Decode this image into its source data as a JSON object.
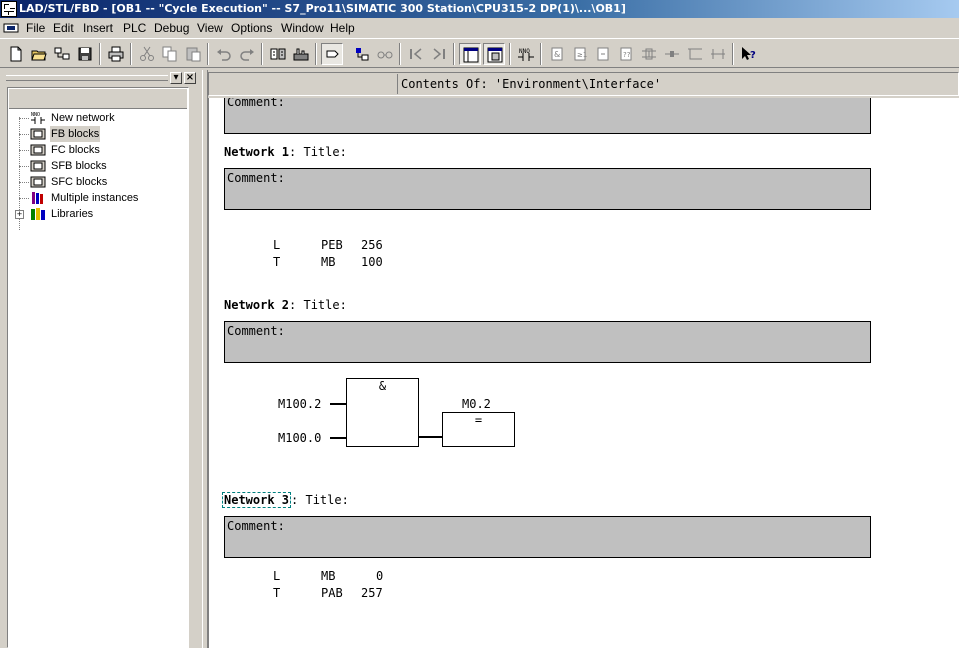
{
  "window": {
    "title": "LAD/STL/FBD  - [OB1 -- \"Cycle Execution\" -- S7_Pro11\\SIMATIC 300 Station\\CPU315-2 DP(1)\\...\\OB1]"
  },
  "menu": [
    "File",
    "Edit",
    "Insert",
    "PLC",
    "Debug",
    "View",
    "Options",
    "Window",
    "Help"
  ],
  "left_panel": {
    "close_glyph": "×",
    "pin_glyph": "▾",
    "tree": [
      {
        "label": "New network",
        "icon": "new-network-icon"
      },
      {
        "label": "FB blocks",
        "icon": "fb-blocks-icon",
        "selected": true
      },
      {
        "label": "FC blocks",
        "icon": "fc-blocks-icon"
      },
      {
        "label": "SFB blocks",
        "icon": "sfb-blocks-icon"
      },
      {
        "label": "SFC blocks",
        "icon": "sfc-blocks-icon"
      },
      {
        "label": "Multiple instances",
        "icon": "multiple-instances-icon"
      },
      {
        "label": "Libraries",
        "icon": "libraries-icon",
        "expander": "+"
      }
    ]
  },
  "editor": {
    "contents_of": "Contents Of: 'Environment\\Interface'",
    "top_comment_label": "Comment:",
    "networks": [
      {
        "label": "Network 1",
        "title_suffix": ": Title:",
        "comment_label": "Comment:",
        "stl": [
          {
            "op": "L",
            "operand": "PEB",
            "value": "256"
          },
          {
            "op": "T",
            "operand": "MB",
            "value": "100"
          }
        ]
      },
      {
        "label": "Network 2",
        "title_suffix": ": Title:",
        "comment_label": "Comment:",
        "fbd": {
          "and_symbol": "&",
          "input_1": "M100.2",
          "input_2": "M100.0",
          "output": "M0.2",
          "assign_symbol": "="
        }
      },
      {
        "label": "Network 3",
        "title_suffix": ": Title:",
        "comment_label": "Comment:",
        "stl": [
          {
            "op": "L",
            "operand": "MB",
            "value": "0"
          },
          {
            "op": "T",
            "operand": "PAB",
            "value": "257"
          }
        ]
      }
    ]
  }
}
